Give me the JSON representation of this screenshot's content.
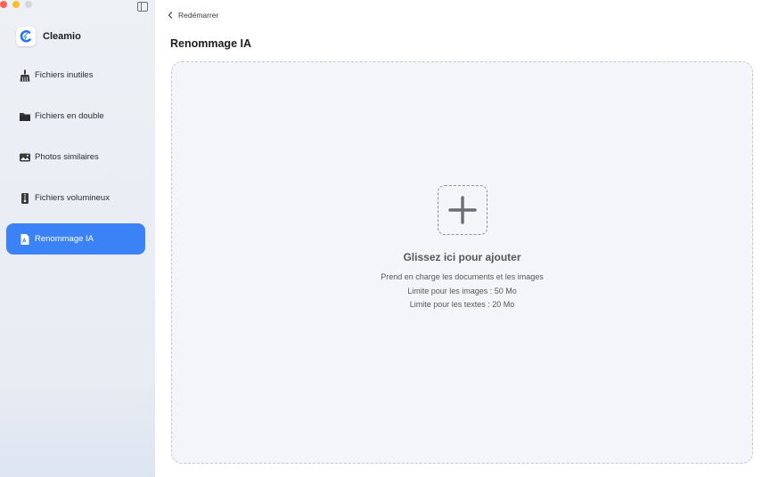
{
  "app": {
    "name": "Cleamio",
    "accent_color": "#3b82f6"
  },
  "window_controls": [
    "close-icon",
    "minimize-icon",
    "zoom-icon"
  ],
  "sidebar": {
    "toggle_icon": "sidebar-toggle-icon",
    "items": [
      {
        "label": "Fichiers inutiles",
        "icon": "broom-icon",
        "active": false
      },
      {
        "label": "Fichiers en double",
        "icon": "folder-icon",
        "active": false
      },
      {
        "label": "Photos similaires",
        "icon": "photo-icon",
        "active": false
      },
      {
        "label": "Fichiers volumineux",
        "icon": "zip-file-icon",
        "active": false
      },
      {
        "label": "Renommage IA",
        "icon": "ai-document-icon",
        "active": true
      }
    ]
  },
  "header": {
    "back_label": "Redémarrer",
    "title": "Renommage IA"
  },
  "dropzone": {
    "icon": "plus-icon",
    "title": "Glissez ici pour ajouter",
    "support": "Prend en charge les documents et les images",
    "image_limit": "Limite pour les images : 50 Mo",
    "text_limit": "Limite pour les textes : 20 Mo"
  }
}
